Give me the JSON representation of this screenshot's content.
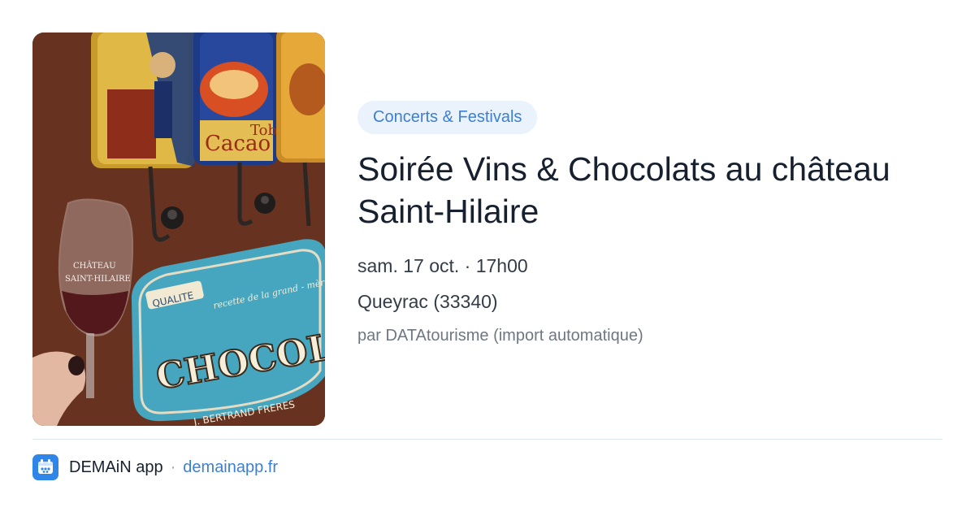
{
  "event": {
    "category": "Concerts & Festivals",
    "title": "Soirée Vins & Chocolats au château Saint-Hilaire",
    "datetime": "sam. 17 oct. · 17h00",
    "location": "Queyrac (33340)",
    "source": "par DATAtourisme (import automatique)"
  },
  "photo": {
    "sign_text": "CHOCOLAT",
    "sign_subtitle": "recette de la grand - mère",
    "sign_badge": "QUALITE",
    "sign_maker": "J. BERTRAND FRERES",
    "glass_text_line1": "CHÂTEAU",
    "glass_text_line2": "SAINT-HILAIRE",
    "tin_text": "Cacao",
    "tin_text_2": "Tob"
  },
  "footer": {
    "app_name": "DEMAiN app",
    "separator": "·",
    "domain": "demainapp.fr",
    "app_icon": "demain-app-icon"
  },
  "colors": {
    "accent": "#3d7fd1",
    "chip_background": "#eaf2fc",
    "title": "#17202e",
    "muted": "#6f7782"
  }
}
